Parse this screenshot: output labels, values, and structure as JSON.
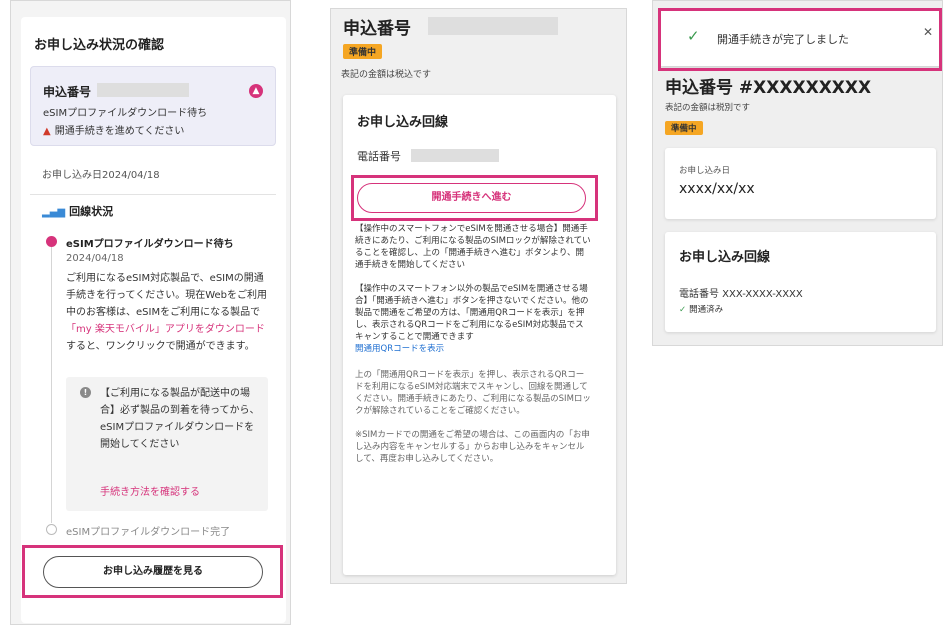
{
  "panel1": {
    "title": "お申し込み状況の確認",
    "application_label": "申込番号",
    "status": "eSIMプロファイルダウンロード待ち",
    "warning": "開通手続きを進めてください",
    "application_date": "お申し込み日2024/04/18",
    "line_status_heading": "回線状況",
    "step1": {
      "title": "eSIMプロファイルダウンロード待ち",
      "date": "2024/04/18",
      "body_before_link": "ご利用になるeSIM対応製品で、eSIMの開通手続きを行ってください。現在Webをご利用中のお客様は、eSIMをご利用になる製品で",
      "link": "「my 楽天モバイル」アプリをダウンロード",
      "body_after_link": "すると、ワンクリックで開通ができます。"
    },
    "note": {
      "text": "【ご利用になる製品が配送中の場合】必ず製品の到着を待ってから、eSIMプロファイルダウンロードを開始してください",
      "link": "手続き方法を確認する"
    },
    "step2": {
      "title": "eSIMプロファイルダウンロード完了"
    },
    "history_button": "お申し込み履歴を見る"
  },
  "panel2": {
    "application_label": "申込番号",
    "badge": "準備中",
    "tax_note": "表記の金額は税込です",
    "card_title": "お申し込み回線",
    "phone_label": "電話番号",
    "proceed_button": "開通手続きへ進む",
    "para1": "【操作中のスマートフォンでeSIMを開通させる場合】開通手続きにあたり、ご利用になる製品のSIMロックが解除されていることを確認し、上の「開通手続きへ進む」ボタンより、開通手続きを開始してください",
    "para2": "【操作中のスマートフォン以外の製品でeSIMを開通させる場合】「開通手続きへ進む」ボタンを押さないでください。他の製品で開通をご希望の方は、「開通用QRコードを表示」を押し、表示されるQRコードをご利用になるeSIM対応製品でスキャンすることで開通できます",
    "qr_link": "開通用QRコードを表示",
    "para3": "上の「開通用QRコードを表示」を押し、表示されるQRコードを利用になるeSIM対応端末でスキャンし、回線を開通してください。開通手続きにあたり、ご利用になる製品のSIMロックが解除されていることをご確認ください。",
    "para4": "※SIMカードでの開通をご希望の場合は、この画面内の「お申し込み内容をキャンセルする」からお申し込みをキャンセルして、再度お申し込みしてください。"
  },
  "panel3": {
    "toast_message": "開通手続きが完了しました",
    "application_number": "申込番号 #XXXXXXXXX",
    "tax_note": "表記の金額は税別です",
    "badge": "準備中",
    "date_label": "お申し込み日",
    "date_value": "xxxx/xx/xx",
    "card_title": "お申し込み回線",
    "phone": "電話番号 XXX-XXXX-XXXX",
    "activated": "開通済み"
  },
  "colors": {
    "accent": "#d6337b",
    "badge": "#f5a623",
    "success": "#3a9a4e",
    "link": "#1f6fd1"
  },
  "icons": [
    "collapse-icon",
    "warning-icon",
    "signal-bars-icon",
    "info-icon",
    "check-icon",
    "close-icon"
  ]
}
